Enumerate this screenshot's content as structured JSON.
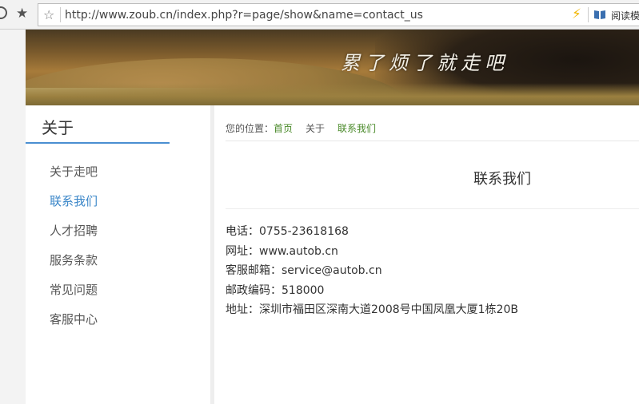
{
  "browser": {
    "star_glyph": "★",
    "url_star_glyph": "☆",
    "url": "http://www.zoub.cn/index.php?r=page/show&name=contact_us",
    "bolt_glyph": "⚡",
    "reader_label": "阅读模"
  },
  "banner": {
    "slogan": "累了烦了就走吧"
  },
  "sidebar": {
    "title": "关于",
    "items": [
      {
        "label": "关于走吧",
        "active": false
      },
      {
        "label": "联系我们",
        "active": true
      },
      {
        "label": "人才招聘",
        "active": false
      },
      {
        "label": "服务条款",
        "active": false
      },
      {
        "label": "常见问题",
        "active": false
      },
      {
        "label": "客服中心",
        "active": false
      }
    ]
  },
  "breadcrumb": {
    "prefix": "您的位置：",
    "home": "首页",
    "section": "关于",
    "current": "联系我们"
  },
  "content": {
    "title": "联系我们",
    "lines": [
      "电话：0755-23618168",
      "网址：www.autob.cn",
      "客服邮箱：service@autob.cn",
      "邮政编码：518000",
      "地址：深圳市福田区深南大道2008号中国凤凰大厦1栋20B"
    ]
  },
  "colors": {
    "accent": "#4a8fd1",
    "active_link": "#3a86c8",
    "breadcrumb_link": "#4a8a2a"
  }
}
